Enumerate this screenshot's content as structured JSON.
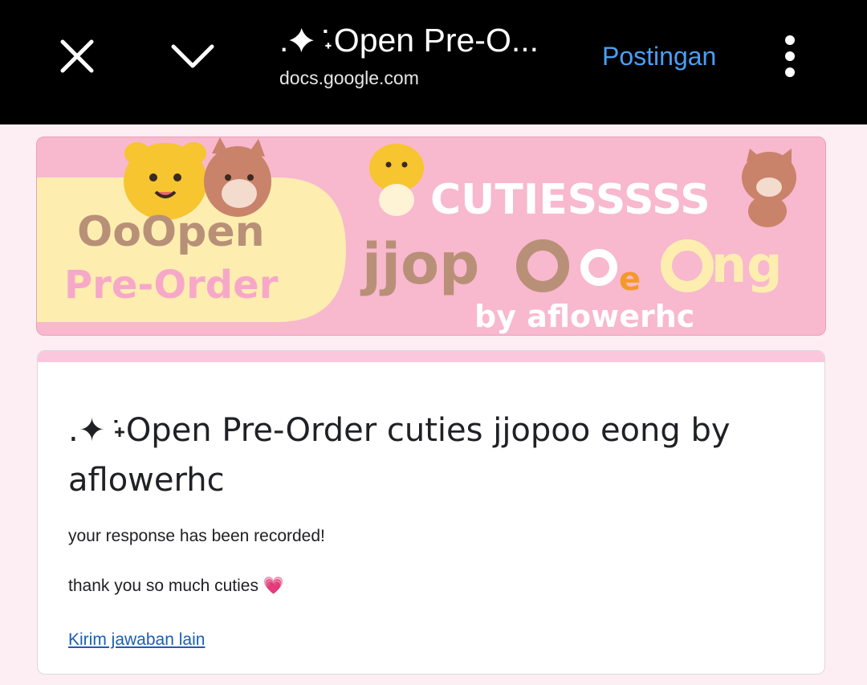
{
  "browser": {
    "title": ".✦ ݁˖Open Pre-O...",
    "url": "docs.google.com",
    "action_label": "Postingan",
    "icons": {
      "close": "close-icon",
      "collapse": "chevron-down-icon",
      "more": "more-vert-icon"
    },
    "accent_color": "#4a9ff5"
  },
  "banner": {
    "left_line1": "OoOpen",
    "left_line2": "Pre-Order",
    "right_line1": "CUTIESSSSS",
    "right_line2a": "jjop",
    "right_line2b": "ng",
    "right_line3": "by aflowerhc",
    "colors": {
      "background": "#f8b8ce",
      "left_blob": "#fdeeb0",
      "brown": "#b89078",
      "pink": "#f7a8c8"
    }
  },
  "form": {
    "title": ".✦ ݁˖Open Pre-Order cuties jjopoo eong by aflowerhc",
    "message_line1": "your response has been recorded!",
    "message_line2": "thank you so much cuties 💗",
    "link_label": "Kirim jawaban lain",
    "accent_color": "#fbc7dc"
  }
}
